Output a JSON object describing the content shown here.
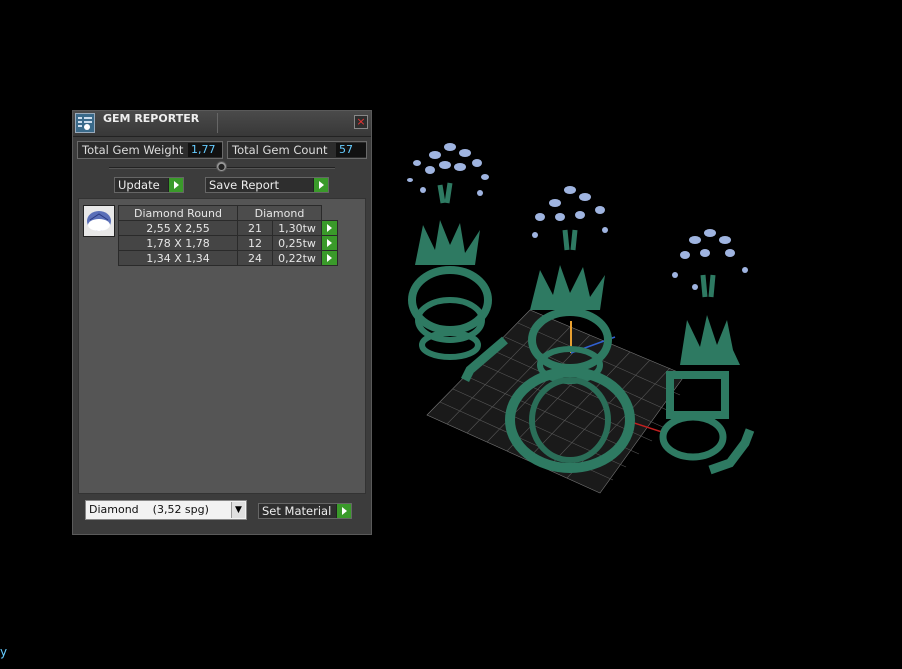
{
  "panel": {
    "title": "GEM REPORTER",
    "close_label": "×",
    "total_gem_weight_label": "Total Gem Weight",
    "total_gem_weight_value": "1,77",
    "total_gem_count_label": "Total Gem Count",
    "total_gem_count_value": "57",
    "update_label": "Update",
    "save_report_label": "Save Report",
    "table": {
      "headers": [
        "Diamond Round",
        "Diamond"
      ],
      "rows": [
        {
          "size": "2,55 X 2,55",
          "count": "21",
          "weight": "1,30tw"
        },
        {
          "size": "1,78 X 1,78",
          "count": "12",
          "weight": "0,25tw"
        },
        {
          "size": "1,34 X 1,34",
          "count": "24",
          "weight": "0,22tw"
        }
      ]
    },
    "material_select_value": "Diamond    (3,52 spg)",
    "set_material_label": "Set Material"
  },
  "corner_text": "y",
  "colors": {
    "accent_value": "#66ccff",
    "go_button": "#3a9a2a",
    "model_green": "#2e7a62",
    "gem_blue": "#9fb4e0"
  }
}
